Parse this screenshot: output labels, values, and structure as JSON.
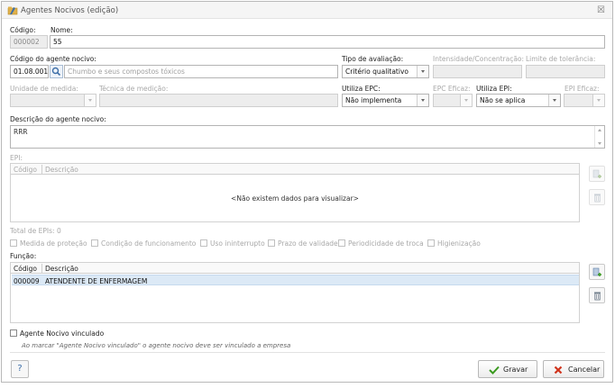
{
  "window": {
    "title": "Agentes Nocivos (edição)",
    "close_glyph": "☒"
  },
  "fields": {
    "codigo": {
      "label": "Código:",
      "value": "000002"
    },
    "nome": {
      "label": "Nome:",
      "value": "55"
    },
    "codigo_agente": {
      "label": "Código do agente nocivo:",
      "value": "01.08.001",
      "description": "Chumbo e seus compostos tóxicos"
    },
    "tipo_avaliacao": {
      "label": "Tipo de avaliação:",
      "value": "Critério qualitativo"
    },
    "intensidade": {
      "label": "Intensidade/Concentração:",
      "value": ""
    },
    "limite": {
      "label": "Limite de tolerância:",
      "value": ""
    },
    "unidade": {
      "label": "Unidade de medida:",
      "value": ""
    },
    "tecnica": {
      "label": "Técnica de medição:",
      "value": ""
    },
    "utiliza_epc": {
      "label": "Utiliza EPC:",
      "value": "Não implementa"
    },
    "epc_eficaz": {
      "label": "EPC Eficaz:",
      "value": ""
    },
    "utiliza_epi": {
      "label": "Utiliza EPI:",
      "value": "Não se aplica"
    },
    "epi_eficaz": {
      "label": "EPI Eficaz:",
      "value": ""
    },
    "descricao": {
      "label": "Descrição do agente nocivo:",
      "value": "RRR"
    }
  },
  "epi": {
    "label": "EPI:",
    "columns": [
      "Código",
      "Descrição"
    ],
    "empty_message": "<Não existem dados para visualizar>",
    "total": "Total de EPIs: 0",
    "options": [
      "Medida de proteção",
      "Condição de funcionamento",
      "Uso ininterrupto",
      "Prazo de validade",
      "Periodicidade de troca",
      "Higienização"
    ]
  },
  "funcao": {
    "label": "Função:",
    "columns": [
      "Código",
      "Descrição"
    ],
    "rows": [
      {
        "codigo": "000009",
        "descricao": "ATENDENTE DE ENFERMAGEM"
      }
    ]
  },
  "vinculado": {
    "label": "Agente Nocivo vinculado",
    "note": "Ao marcar \"Agente Nocivo vinculado\" o agente nocivo deve ser vinculado a empresa"
  },
  "buttons": {
    "help": "?",
    "save": "Gravar",
    "cancel": "Cancelar"
  },
  "colors": {
    "accent": "#3d6ea8",
    "save_icon": "#3a9a1f",
    "cancel_icon": "#d0331c",
    "selected_row": "#dce9f6"
  }
}
